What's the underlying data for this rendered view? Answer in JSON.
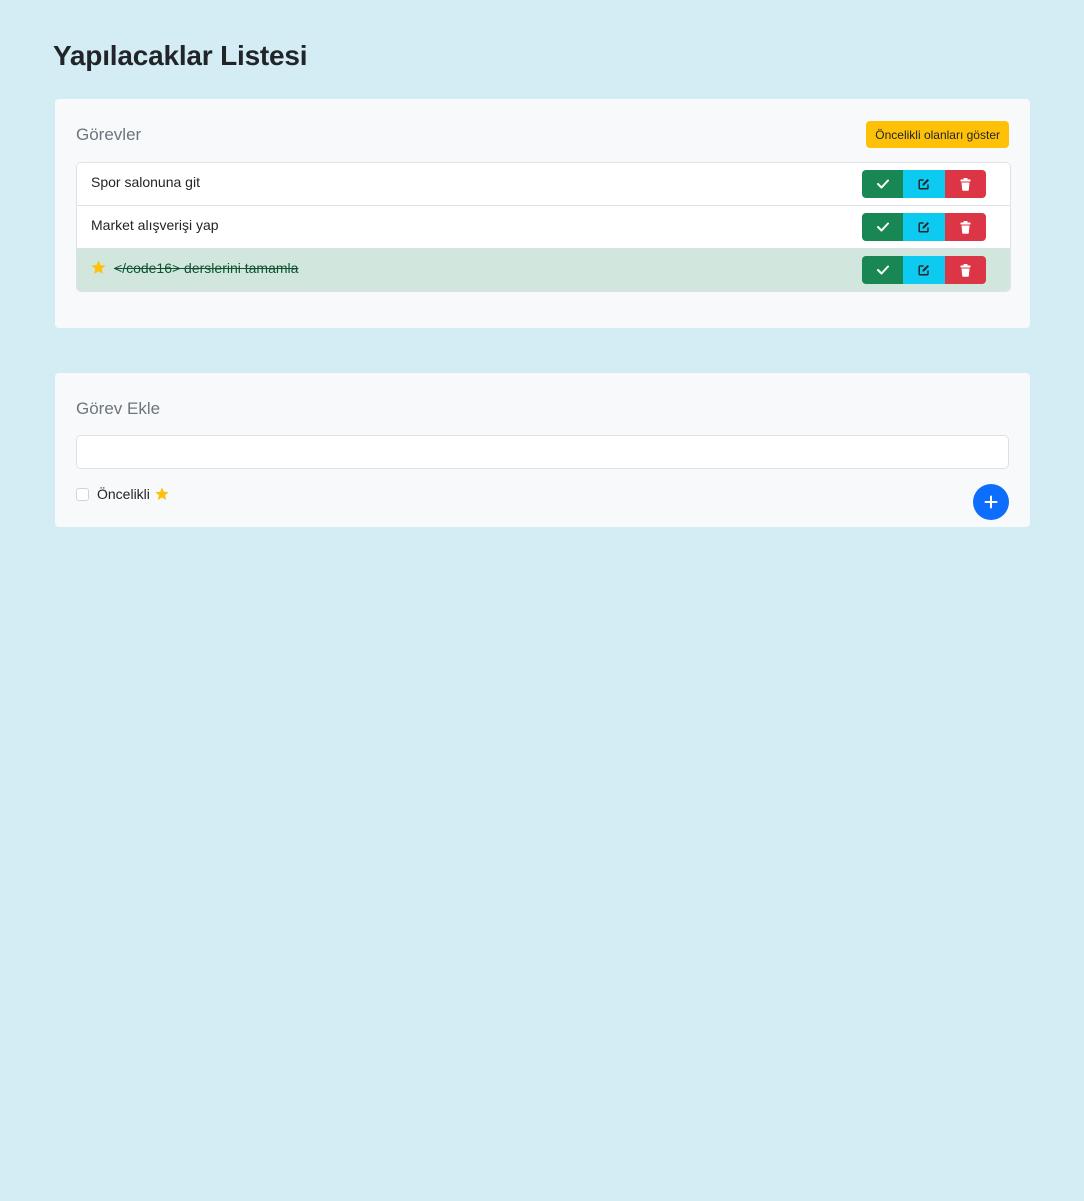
{
  "page": {
    "title": "Yapılacaklar Listesi"
  },
  "tasks_card": {
    "title": "Görevler",
    "priority_filter_label": "Öncelikli olanları göster",
    "items": [
      {
        "text": "Spor salonuna git",
        "completed": false,
        "priority": false
      },
      {
        "text": "Market alışverişi yap",
        "completed": false,
        "priority": false
      },
      {
        "text": "</code16> derslerini tamamla",
        "completed": true,
        "priority": true
      }
    ],
    "actions": {
      "complete_icon": "check-icon",
      "edit_icon": "edit-icon",
      "delete_icon": "trash-icon"
    }
  },
  "add_card": {
    "title": "Görev Ekle",
    "input_value": "",
    "input_placeholder": "",
    "priority_label": "Öncelikli",
    "priority_checked": false,
    "add_icon": "plus-icon"
  },
  "colors": {
    "background": "#d4edf4",
    "card": "#f8f9fa",
    "warning": "#ffc107",
    "success": "#198754",
    "info": "#0dcaf0",
    "danger": "#dc3545",
    "primary": "#0d6efd",
    "completed_row": "#d1e7dd"
  }
}
